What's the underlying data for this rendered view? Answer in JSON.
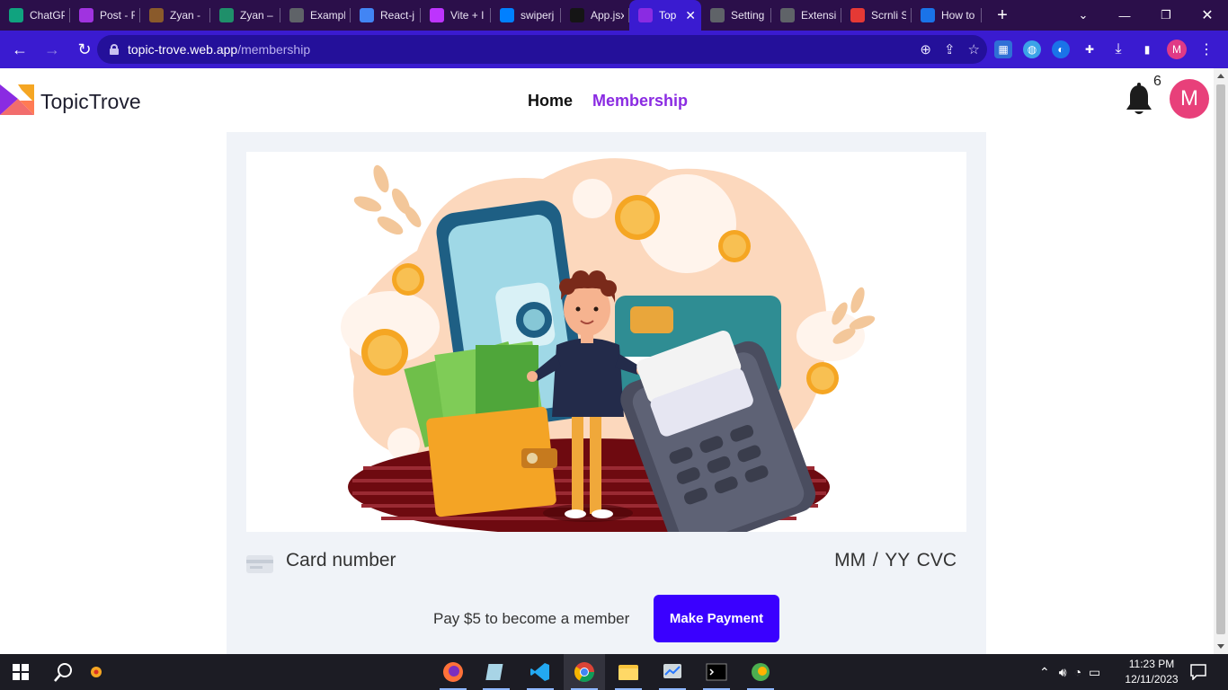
{
  "browser": {
    "tabs": [
      {
        "title": "ChatGP",
        "icon": "chatgpt-icon",
        "color": "#10a37f"
      },
      {
        "title": "Post - F",
        "icon": "post-icon",
        "color": "#a033e0"
      },
      {
        "title": "Zyan -",
        "icon": "zyan-icon",
        "color": "#8a5a2b"
      },
      {
        "title": "Zyan –",
        "icon": "zyan-icon-2",
        "color": "#1f8f6a"
      },
      {
        "title": "Exampl",
        "icon": "globe-icon",
        "color": "#5f6368"
      },
      {
        "title": "React-j",
        "icon": "docs-icon",
        "color": "#4285f4"
      },
      {
        "title": "Vite + I",
        "icon": "vite-icon",
        "color": "#bd34fe"
      },
      {
        "title": "swiperj",
        "icon": "swiper-icon",
        "color": "#0080ff"
      },
      {
        "title": "App.jsx",
        "icon": "codesandbox-icon",
        "color": "#151515"
      },
      {
        "title": "Top",
        "icon": "topictrove-icon",
        "color": "#8a2be2"
      },
      {
        "title": "Setting",
        "icon": "gear-icon",
        "color": "#5f6368"
      },
      {
        "title": "Extensi",
        "icon": "puzzle-icon",
        "color": "#5f6368"
      },
      {
        "title": "Scrnli S",
        "icon": "scrnli-icon",
        "color": "#e53935"
      },
      {
        "title": "How to",
        "icon": "edge-icon",
        "color": "#1a73e8"
      }
    ],
    "active_tab_index": 9,
    "new_tab_label": "+",
    "url_host": "topic-trove.web.app",
    "url_path": "/membership",
    "profile_initial": "M"
  },
  "site": {
    "logo_text": "TopicTrove",
    "nav": {
      "home": "Home",
      "membership": "Membership"
    },
    "notification_count": "6",
    "avatar_initial": "M"
  },
  "payment": {
    "card_placeholder": "Card number",
    "expiry_cvc_placeholder": "MM / YY  CVC",
    "pay_text": "Pay $5 to become a member",
    "pay_button": "Make Payment"
  },
  "taskbar": {
    "apps": [
      "firefox-icon",
      "app-icon",
      "vscode-icon",
      "chrome-icon",
      "file-explorer-icon",
      "task-manager-icon",
      "terminal-icon",
      "app-icon-2"
    ],
    "active_app": "chrome-icon",
    "time": "11:23 PM",
    "date": "12/11/2023"
  },
  "colors": {
    "tab_strip": "#2b0f4a",
    "toolbar": "#3a1bd0",
    "accent_purple": "#8a2be2",
    "pay_button": "#3a00ff",
    "avatar": "#e8407a"
  }
}
